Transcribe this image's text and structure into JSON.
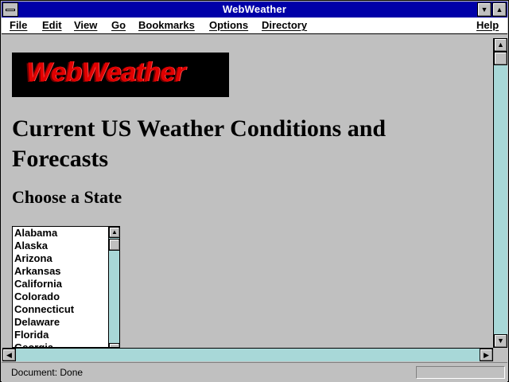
{
  "window": {
    "title": "WebWeather"
  },
  "menubar": {
    "items": [
      {
        "label": "File"
      },
      {
        "label": "Edit"
      },
      {
        "label": "View"
      },
      {
        "label": "Go"
      },
      {
        "label": "Bookmarks"
      },
      {
        "label": "Options"
      },
      {
        "label": "Directory"
      },
      {
        "label": "Help"
      }
    ]
  },
  "page": {
    "logo_text": "WebWeather",
    "heading": "Current US Weather Conditions and Forecasts",
    "subheading": "Choose a State",
    "states": [
      "Alabama",
      "Alaska",
      "Arizona",
      "Arkansas",
      "California",
      "Colorado",
      "Connecticut",
      "Delaware",
      "Florida",
      "Georgia"
    ]
  },
  "status": {
    "text": "Document: Done"
  },
  "colors": {
    "titlebar": "#0000a8",
    "logo_red": "#e00000",
    "scroll_track": "#a8d8d8"
  }
}
